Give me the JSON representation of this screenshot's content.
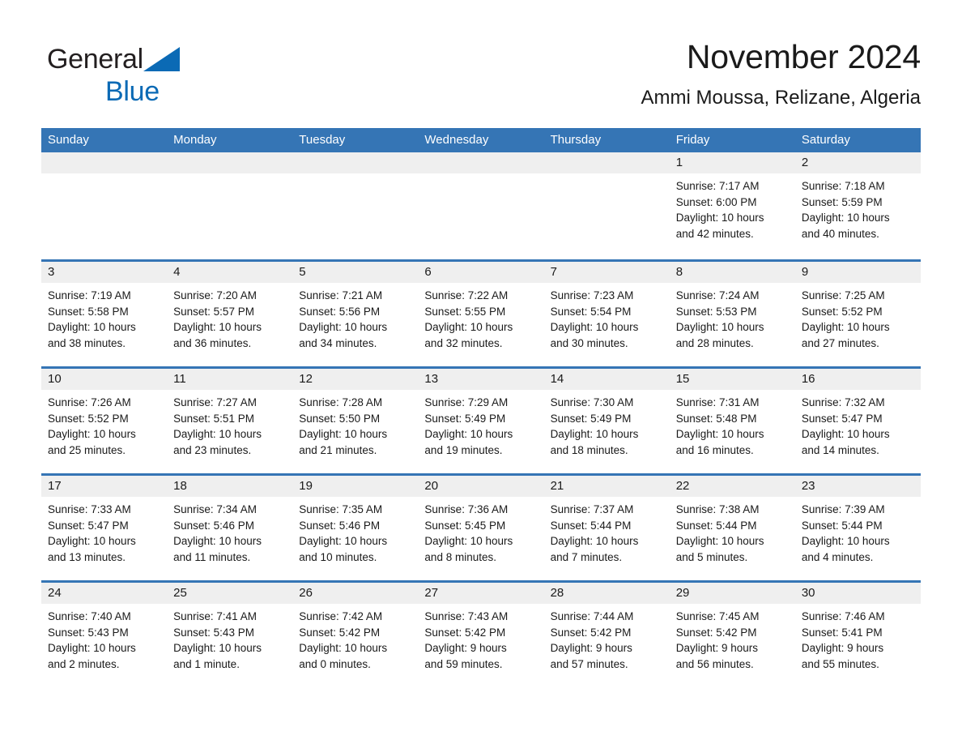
{
  "logo": {
    "text_part1": "General",
    "text_part2": "Blue",
    "triangle_color": "#0b6ab5"
  },
  "header": {
    "title": "November 2024",
    "subtitle": "Ammi Moussa, Relizane, Algeria"
  },
  "theme": {
    "header_blue": "#3575b5",
    "daynum_band": "#efefef",
    "text": "#1a1a1a"
  },
  "weekdays": [
    "Sunday",
    "Monday",
    "Tuesday",
    "Wednesday",
    "Thursday",
    "Friday",
    "Saturday"
  ],
  "weeks": [
    [
      {
        "day": "",
        "lines": []
      },
      {
        "day": "",
        "lines": []
      },
      {
        "day": "",
        "lines": []
      },
      {
        "day": "",
        "lines": []
      },
      {
        "day": "",
        "lines": []
      },
      {
        "day": "1",
        "lines": [
          "Sunrise: 7:17 AM",
          "Sunset: 6:00 PM",
          "Daylight: 10 hours",
          "and 42 minutes."
        ]
      },
      {
        "day": "2",
        "lines": [
          "Sunrise: 7:18 AM",
          "Sunset: 5:59 PM",
          "Daylight: 10 hours",
          "and 40 minutes."
        ]
      }
    ],
    [
      {
        "day": "3",
        "lines": [
          "Sunrise: 7:19 AM",
          "Sunset: 5:58 PM",
          "Daylight: 10 hours",
          "and 38 minutes."
        ]
      },
      {
        "day": "4",
        "lines": [
          "Sunrise: 7:20 AM",
          "Sunset: 5:57 PM",
          "Daylight: 10 hours",
          "and 36 minutes."
        ]
      },
      {
        "day": "5",
        "lines": [
          "Sunrise: 7:21 AM",
          "Sunset: 5:56 PM",
          "Daylight: 10 hours",
          "and 34 minutes."
        ]
      },
      {
        "day": "6",
        "lines": [
          "Sunrise: 7:22 AM",
          "Sunset: 5:55 PM",
          "Daylight: 10 hours",
          "and 32 minutes."
        ]
      },
      {
        "day": "7",
        "lines": [
          "Sunrise: 7:23 AM",
          "Sunset: 5:54 PM",
          "Daylight: 10 hours",
          "and 30 minutes."
        ]
      },
      {
        "day": "8",
        "lines": [
          "Sunrise: 7:24 AM",
          "Sunset: 5:53 PM",
          "Daylight: 10 hours",
          "and 28 minutes."
        ]
      },
      {
        "day": "9",
        "lines": [
          "Sunrise: 7:25 AM",
          "Sunset: 5:52 PM",
          "Daylight: 10 hours",
          "and 27 minutes."
        ]
      }
    ],
    [
      {
        "day": "10",
        "lines": [
          "Sunrise: 7:26 AM",
          "Sunset: 5:52 PM",
          "Daylight: 10 hours",
          "and 25 minutes."
        ]
      },
      {
        "day": "11",
        "lines": [
          "Sunrise: 7:27 AM",
          "Sunset: 5:51 PM",
          "Daylight: 10 hours",
          "and 23 minutes."
        ]
      },
      {
        "day": "12",
        "lines": [
          "Sunrise: 7:28 AM",
          "Sunset: 5:50 PM",
          "Daylight: 10 hours",
          "and 21 minutes."
        ]
      },
      {
        "day": "13",
        "lines": [
          "Sunrise: 7:29 AM",
          "Sunset: 5:49 PM",
          "Daylight: 10 hours",
          "and 19 minutes."
        ]
      },
      {
        "day": "14",
        "lines": [
          "Sunrise: 7:30 AM",
          "Sunset: 5:49 PM",
          "Daylight: 10 hours",
          "and 18 minutes."
        ]
      },
      {
        "day": "15",
        "lines": [
          "Sunrise: 7:31 AM",
          "Sunset: 5:48 PM",
          "Daylight: 10 hours",
          "and 16 minutes."
        ]
      },
      {
        "day": "16",
        "lines": [
          "Sunrise: 7:32 AM",
          "Sunset: 5:47 PM",
          "Daylight: 10 hours",
          "and 14 minutes."
        ]
      }
    ],
    [
      {
        "day": "17",
        "lines": [
          "Sunrise: 7:33 AM",
          "Sunset: 5:47 PM",
          "Daylight: 10 hours",
          "and 13 minutes."
        ]
      },
      {
        "day": "18",
        "lines": [
          "Sunrise: 7:34 AM",
          "Sunset: 5:46 PM",
          "Daylight: 10 hours",
          "and 11 minutes."
        ]
      },
      {
        "day": "19",
        "lines": [
          "Sunrise: 7:35 AM",
          "Sunset: 5:46 PM",
          "Daylight: 10 hours",
          "and 10 minutes."
        ]
      },
      {
        "day": "20",
        "lines": [
          "Sunrise: 7:36 AM",
          "Sunset: 5:45 PM",
          "Daylight: 10 hours",
          "and 8 minutes."
        ]
      },
      {
        "day": "21",
        "lines": [
          "Sunrise: 7:37 AM",
          "Sunset: 5:44 PM",
          "Daylight: 10 hours",
          "and 7 minutes."
        ]
      },
      {
        "day": "22",
        "lines": [
          "Sunrise: 7:38 AM",
          "Sunset: 5:44 PM",
          "Daylight: 10 hours",
          "and 5 minutes."
        ]
      },
      {
        "day": "23",
        "lines": [
          "Sunrise: 7:39 AM",
          "Sunset: 5:44 PM",
          "Daylight: 10 hours",
          "and 4 minutes."
        ]
      }
    ],
    [
      {
        "day": "24",
        "lines": [
          "Sunrise: 7:40 AM",
          "Sunset: 5:43 PM",
          "Daylight: 10 hours",
          "and 2 minutes."
        ]
      },
      {
        "day": "25",
        "lines": [
          "Sunrise: 7:41 AM",
          "Sunset: 5:43 PM",
          "Daylight: 10 hours",
          "and 1 minute."
        ]
      },
      {
        "day": "26",
        "lines": [
          "Sunrise: 7:42 AM",
          "Sunset: 5:42 PM",
          "Daylight: 10 hours",
          "and 0 minutes."
        ]
      },
      {
        "day": "27",
        "lines": [
          "Sunrise: 7:43 AM",
          "Sunset: 5:42 PM",
          "Daylight: 9 hours",
          "and 59 minutes."
        ]
      },
      {
        "day": "28",
        "lines": [
          "Sunrise: 7:44 AM",
          "Sunset: 5:42 PM",
          "Daylight: 9 hours",
          "and 57 minutes."
        ]
      },
      {
        "day": "29",
        "lines": [
          "Sunrise: 7:45 AM",
          "Sunset: 5:42 PM",
          "Daylight: 9 hours",
          "and 56 minutes."
        ]
      },
      {
        "day": "30",
        "lines": [
          "Sunrise: 7:46 AM",
          "Sunset: 5:41 PM",
          "Daylight: 9 hours",
          "and 55 minutes."
        ]
      }
    ]
  ]
}
